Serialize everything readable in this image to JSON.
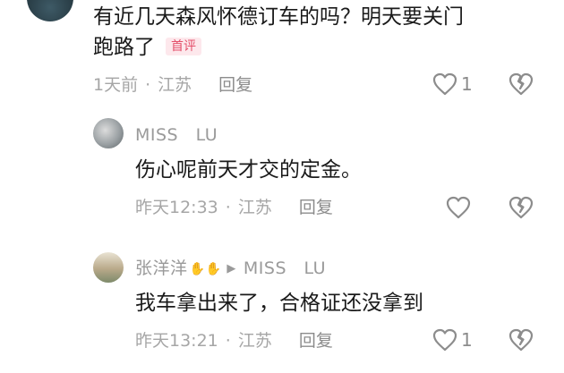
{
  "comments": [
    {
      "text_line1": "有近几天森风怀德订车的吗？明天要关门",
      "text_line2": "跑路了",
      "badge": "首评",
      "time": "1天前",
      "location": "江苏",
      "reply_label": "回复",
      "like_count": "1"
    },
    {
      "username": "MISS　LU",
      "text": "伤心呢前天才交的定金。",
      "time": "昨天12:33",
      "location": "江苏",
      "reply_label": "回复",
      "like_count": ""
    },
    {
      "username": "张洋洋",
      "reply_to": "MISS　LU",
      "text": "我车拿出来了，合格证还没拿到",
      "time": "昨天13:21",
      "location": "江苏",
      "reply_label": "回复",
      "like_count": "1"
    }
  ],
  "meta_separator": "·",
  "colors": {
    "badge_text": "#e4506b",
    "badge_bg": "#fde8ec",
    "meta": "#a6a6a6",
    "icon": "#8c8c8c"
  }
}
